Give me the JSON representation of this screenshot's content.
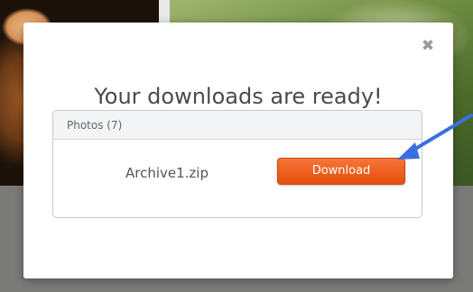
{
  "dialog": {
    "title": "Your downloads are ready!",
    "close_icon": "close-icon",
    "panel": {
      "header": "Photos (7)",
      "files": [
        {
          "name": "Archive1.zip",
          "action_label": "Download"
        }
      ]
    }
  },
  "colors": {
    "accent": "#EE5C1C",
    "arrow": "#3A6FE0",
    "title_text": "#4A4A4A"
  },
  "annotation": {
    "icon": "arrow-pointer-icon"
  }
}
